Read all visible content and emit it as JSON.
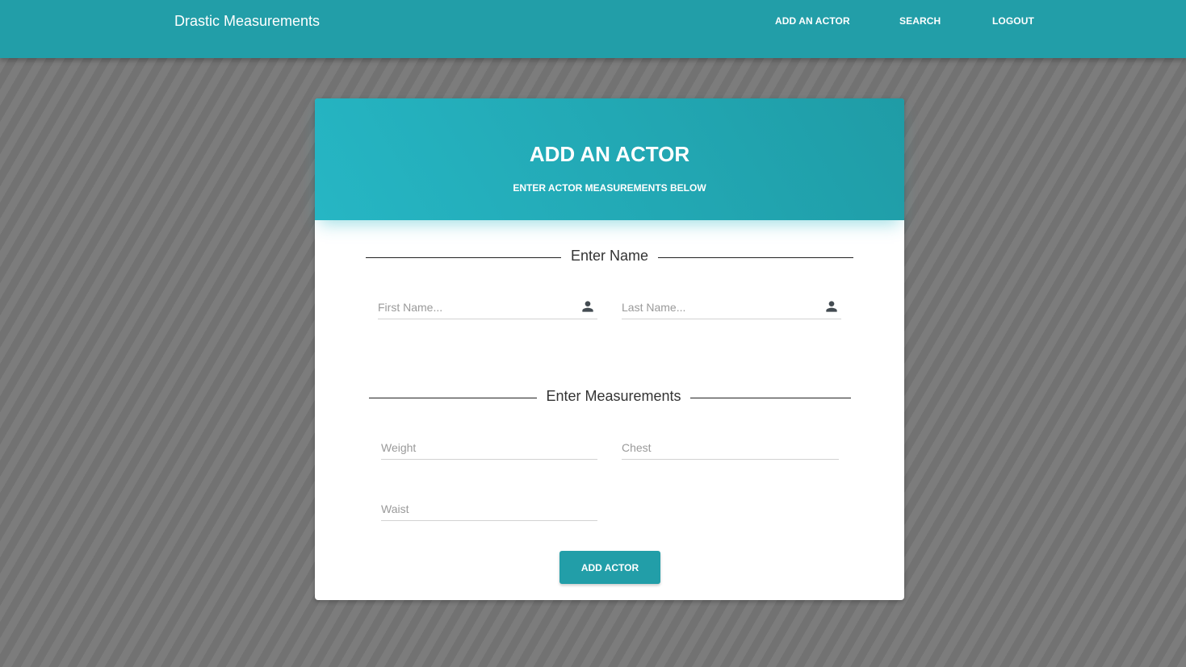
{
  "navbar": {
    "brand": "Drastic Measurements",
    "links": {
      "add_actor": "ADD AN ACTOR",
      "search": "SEARCH",
      "logout": "LOGOUT"
    }
  },
  "card": {
    "title": "ADD AN ACTOR",
    "subtitle": "ENTER ACTOR MEASUREMENTS BELOW",
    "name_section": {
      "title": "Enter Name",
      "first_name_placeholder": "First Name...",
      "last_name_placeholder": "Last Name...",
      "first_name_value": "",
      "last_name_value": ""
    },
    "measurements_section": {
      "title": "Enter Measurements",
      "weight_placeholder": "Weight",
      "chest_placeholder": "Chest",
      "waist_placeholder": "Waist"
    },
    "submit_label": "ADD ACTOR"
  },
  "icons": {
    "name_field_icon": "person-icon"
  },
  "colors": {
    "primary": "#229ea8",
    "header_gradient_start": "#26b6c4",
    "header_gradient_end": "#1f9ca6",
    "background": "#767676"
  }
}
